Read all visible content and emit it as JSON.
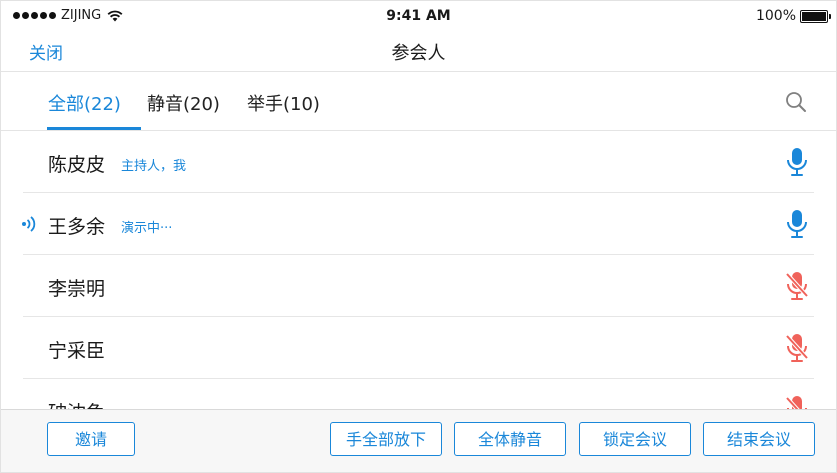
{
  "status_bar": {
    "carrier": "ZIJING",
    "time": "9:41 AM",
    "battery": "100%"
  },
  "nav": {
    "close_label": "关闭",
    "title": "参会人"
  },
  "tabs": [
    {
      "label": "全部(22)",
      "active": true
    },
    {
      "label": "静音(20)",
      "active": false
    },
    {
      "label": "举手(10)",
      "active": false
    }
  ],
  "participants": [
    {
      "name": "陈皮皮",
      "tag": "主持人，我",
      "speaking": false,
      "mic": "on"
    },
    {
      "name": "王多余",
      "tag": "演示中···",
      "speaking": true,
      "mic": "on"
    },
    {
      "name": "李崇明",
      "tag": "",
      "speaking": false,
      "mic": "muted"
    },
    {
      "name": "宁采臣",
      "tag": "",
      "speaking": false,
      "mic": "muted"
    },
    {
      "name": "砷沈兔",
      "tag": "",
      "speaking": false,
      "mic": "muted"
    }
  ],
  "toolbar": {
    "invite_label": "邀请",
    "lower_all_hands_label": "手全部放下",
    "mute_all_label": "全体静音",
    "lock_meeting_label": "锁定会议",
    "end_meeting_label": "结束会议"
  },
  "colors": {
    "accent": "#1a87d9",
    "muted_mic": "#f0625a"
  },
  "icons": {
    "search": "search-icon",
    "mic_on": "microphone-icon",
    "mic_muted": "microphone-muted-icon",
    "speaking": "speaking-icon"
  }
}
